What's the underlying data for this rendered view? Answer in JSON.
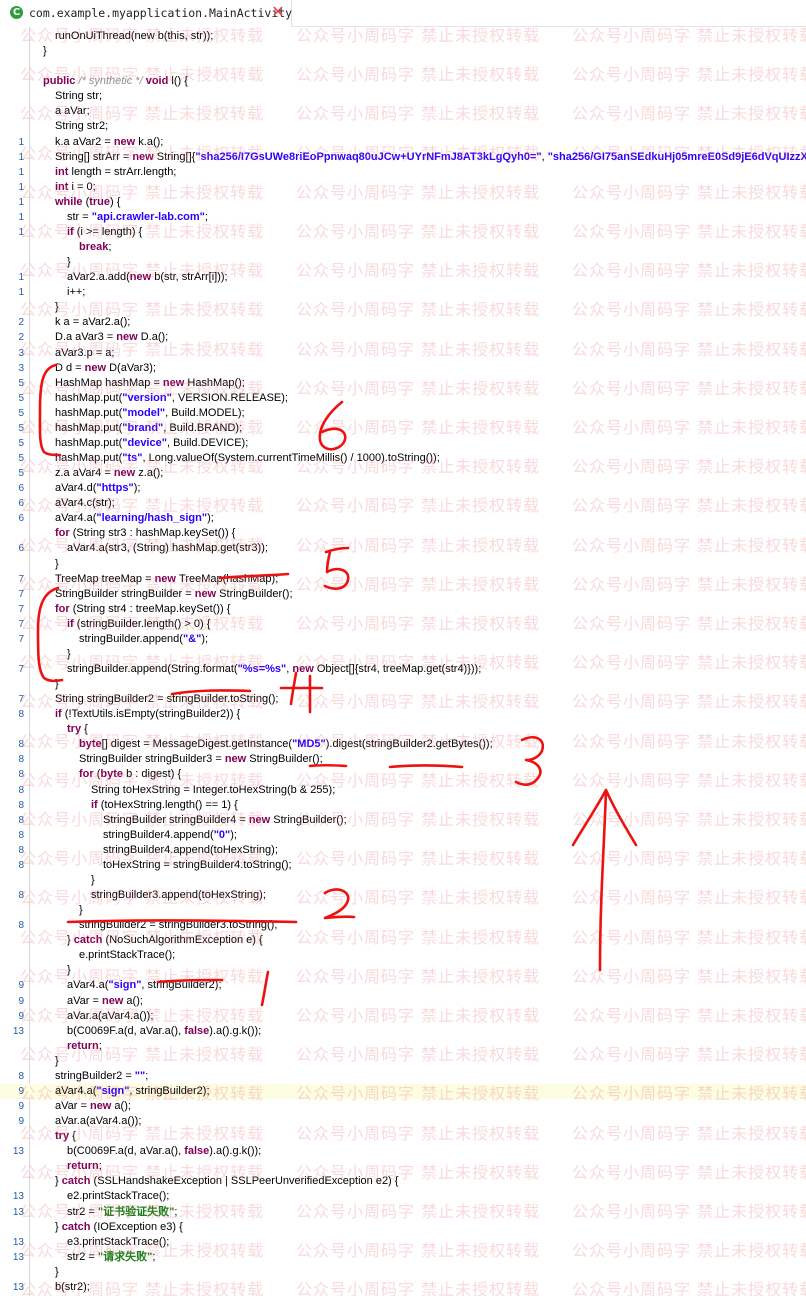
{
  "tab": {
    "title": "com.example.myapplication.MainActivity",
    "icon": "java-class-icon",
    "close_icon": "close-icon"
  },
  "watermark": "公众号小周码字 禁止未授权转载",
  "annotations": {
    "color": "#ee1111",
    "labels": [
      "6",
      "5",
      "4",
      "3",
      "2",
      "1"
    ]
  },
  "lines": [
    {
      "n": "",
      "indent": 2,
      "tokens": [
        [
          "",
          "runOnUiThread(new b(this, str));"
        ]
      ]
    },
    {
      "n": "",
      "indent": 1,
      "tokens": [
        [
          "",
          "}"
        ]
      ]
    },
    {
      "n": "",
      "indent": 0,
      "tokens": [
        [
          "",
          ""
        ]
      ]
    },
    {
      "n": "",
      "indent": 1,
      "tokens": [
        [
          "kw",
          "public "
        ],
        [
          "cm",
          "/* synthetic */ "
        ],
        [
          "kw",
          "void "
        ],
        [
          "",
          "l() {"
        ]
      ]
    },
    {
      "n": "",
      "indent": 2,
      "tokens": [
        [
          "",
          "String str;"
        ]
      ]
    },
    {
      "n": "",
      "indent": 2,
      "tokens": [
        [
          "",
          "a aVar;"
        ]
      ]
    },
    {
      "n": "",
      "indent": 2,
      "tokens": [
        [
          "",
          "String str2;"
        ]
      ]
    },
    {
      "n": "1",
      "indent": 2,
      "tokens": [
        [
          "",
          "k.a aVar2 = "
        ],
        [
          "kw",
          "new "
        ],
        [
          "",
          "k.a();"
        ]
      ]
    },
    {
      "n": "1",
      "indent": 2,
      "tokens": [
        [
          "",
          "String[] strArr = "
        ],
        [
          "kw",
          "new "
        ],
        [
          "",
          "String[]{"
        ],
        [
          "str",
          "\"sha256/I7GsUWe8riEoPpnwaq80uJCw+UYrNFmJ8AT3kLgQyh0=\""
        ],
        [
          "",
          ", "
        ],
        [
          "str",
          "\"sha256/GI75anSEdkuHj05mreE0Sd9jE6dVqUIzzXRHHlZBVbI=\""
        ]
      ]
    },
    {
      "n": "1",
      "indent": 2,
      "tokens": [
        [
          "kw",
          "int "
        ],
        [
          "",
          "length = strArr.length;"
        ]
      ]
    },
    {
      "n": "1",
      "indent": 2,
      "tokens": [
        [
          "kw",
          "int "
        ],
        [
          "",
          "i = 0;"
        ]
      ]
    },
    {
      "n": "1",
      "indent": 2,
      "tokens": [
        [
          "kw",
          "while "
        ],
        [
          "",
          "("
        ],
        [
          "kw",
          "true"
        ],
        [
          "",
          ") {"
        ]
      ]
    },
    {
      "n": "1",
      "indent": 3,
      "tokens": [
        [
          "",
          "str = "
        ],
        [
          "str",
          "\"api.crawler-lab.com\""
        ],
        [
          "",
          ";"
        ]
      ]
    },
    {
      "n": "1",
      "indent": 3,
      "tokens": [
        [
          "kw",
          "if "
        ],
        [
          "",
          "(i >= length) {"
        ]
      ]
    },
    {
      "n": "",
      "indent": 4,
      "tokens": [
        [
          "kw",
          "break"
        ],
        [
          "",
          ";"
        ]
      ]
    },
    {
      "n": "",
      "indent": 3,
      "tokens": [
        [
          "",
          "}"
        ]
      ]
    },
    {
      "n": "1",
      "indent": 3,
      "tokens": [
        [
          "",
          "aVar2.a.add("
        ],
        [
          "kw",
          "new "
        ],
        [
          "",
          "b(str, strArr[i]));"
        ]
      ]
    },
    {
      "n": "1",
      "indent": 3,
      "tokens": [
        [
          "",
          "i++;"
        ]
      ]
    },
    {
      "n": "",
      "indent": 2,
      "tokens": [
        [
          "",
          "}"
        ]
      ]
    },
    {
      "n": "2",
      "indent": 2,
      "tokens": [
        [
          "",
          "k a = aVar2.a();"
        ]
      ]
    },
    {
      "n": "2",
      "indent": 2,
      "tokens": [
        [
          "",
          "D.a aVar3 = "
        ],
        [
          "kw",
          "new "
        ],
        [
          "",
          "D.a();"
        ]
      ]
    },
    {
      "n": "3",
      "indent": 2,
      "tokens": [
        [
          "",
          "aVar3.p = a;"
        ]
      ]
    },
    {
      "n": "3",
      "indent": 2,
      "tokens": [
        [
          "",
          "D d = "
        ],
        [
          "kw",
          "new "
        ],
        [
          "",
          "D(aVar3);"
        ]
      ]
    },
    {
      "n": "5",
      "indent": 2,
      "tokens": [
        [
          "",
          "HashMap hashMap = "
        ],
        [
          "kw",
          "new "
        ],
        [
          "",
          "HashMap();"
        ]
      ]
    },
    {
      "n": "5",
      "indent": 2,
      "tokens": [
        [
          "",
          "hashMap.put("
        ],
        [
          "str",
          "\"version\""
        ],
        [
          "",
          ", VERSION.RELEASE);"
        ]
      ]
    },
    {
      "n": "5",
      "indent": 2,
      "tokens": [
        [
          "",
          "hashMap.put("
        ],
        [
          "str",
          "\"model\""
        ],
        [
          "",
          ", Build.MODEL);"
        ]
      ]
    },
    {
      "n": "5",
      "indent": 2,
      "tokens": [
        [
          "",
          "hashMap.put("
        ],
        [
          "str",
          "\"brand\""
        ],
        [
          "",
          ", Build.BRAND);"
        ]
      ]
    },
    {
      "n": "5",
      "indent": 2,
      "tokens": [
        [
          "",
          "hashMap.put("
        ],
        [
          "str",
          "\"device\""
        ],
        [
          "",
          ", Build.DEVICE);"
        ]
      ]
    },
    {
      "n": "5",
      "indent": 2,
      "tokens": [
        [
          "",
          "hashMap.put("
        ],
        [
          "str",
          "\"ts\""
        ],
        [
          "",
          ", Long.valueOf(System.currentTimeMillis() / 1000).toString());"
        ]
      ]
    },
    {
      "n": "5",
      "indent": 2,
      "tokens": [
        [
          "",
          "z.a aVar4 = "
        ],
        [
          "kw",
          "new "
        ],
        [
          "",
          "z.a();"
        ]
      ]
    },
    {
      "n": "6",
      "indent": 2,
      "tokens": [
        [
          "",
          "aVar4.d("
        ],
        [
          "str",
          "\"https\""
        ],
        [
          "",
          ");"
        ]
      ]
    },
    {
      "n": "6",
      "indent": 2,
      "tokens": [
        [
          "",
          "aVar4.c(str);"
        ]
      ]
    },
    {
      "n": "6",
      "indent": 2,
      "tokens": [
        [
          "",
          "aVar4.a("
        ],
        [
          "str",
          "\"learning/hash_sign\""
        ],
        [
          "",
          ");"
        ]
      ]
    },
    {
      "n": "",
      "indent": 2,
      "tokens": [
        [
          "kw",
          "for "
        ],
        [
          "",
          "(String str3 : hashMap.keySet()) {"
        ]
      ]
    },
    {
      "n": "6",
      "indent": 3,
      "tokens": [
        [
          "",
          "aVar4.a(str3, (String) hashMap.get(str3));"
        ]
      ]
    },
    {
      "n": "",
      "indent": 2,
      "tokens": [
        [
          "",
          "}"
        ]
      ]
    },
    {
      "n": "7",
      "indent": 2,
      "tokens": [
        [
          "",
          "TreeMap treeMap = "
        ],
        [
          "kw",
          "new "
        ],
        [
          "",
          "TreeMap(hashMap);"
        ]
      ]
    },
    {
      "n": "7",
      "indent": 2,
      "tokens": [
        [
          "",
          "StringBuilder stringBuilder = "
        ],
        [
          "kw",
          "new "
        ],
        [
          "",
          "StringBuilder();"
        ]
      ]
    },
    {
      "n": "7",
      "indent": 2,
      "tokens": [
        [
          "kw",
          "for "
        ],
        [
          "",
          "(String str4 : treeMap.keySet()) {"
        ]
      ]
    },
    {
      "n": "7",
      "indent": 3,
      "tokens": [
        [
          "kw",
          "if "
        ],
        [
          "",
          "(stringBuilder.length() > 0) {"
        ]
      ]
    },
    {
      "n": "7",
      "indent": 4,
      "tokens": [
        [
          "",
          "stringBuilder.append("
        ],
        [
          "str",
          "\"&\""
        ],
        [
          "",
          ");"
        ]
      ]
    },
    {
      "n": "",
      "indent": 3,
      "tokens": [
        [
          "",
          "}"
        ]
      ]
    },
    {
      "n": "7",
      "indent": 3,
      "tokens": [
        [
          "",
          "stringBuilder.append(String.format("
        ],
        [
          "str",
          "\"%s=%s\""
        ],
        [
          "",
          ", "
        ],
        [
          "kw",
          "new "
        ],
        [
          "",
          "Object[]{str4, treeMap.get(str4)}));"
        ]
      ]
    },
    {
      "n": "",
      "indent": 2,
      "tokens": [
        [
          "",
          "}"
        ]
      ]
    },
    {
      "n": "7",
      "indent": 2,
      "tokens": [
        [
          "",
          "String stringBuilder2 = stringBuilder.toString();"
        ]
      ]
    },
    {
      "n": "8",
      "indent": 2,
      "tokens": [
        [
          "kw",
          "if "
        ],
        [
          "",
          "(!TextUtils.isEmpty(stringBuilder2)) {"
        ]
      ]
    },
    {
      "n": "",
      "indent": 3,
      "tokens": [
        [
          "kw",
          "try "
        ],
        [
          "",
          "{"
        ]
      ]
    },
    {
      "n": "8",
      "indent": 4,
      "tokens": [
        [
          "kw",
          "byte"
        ],
        [
          "",
          "[] digest = MessageDigest.getInstance("
        ],
        [
          "str",
          "\"MD5\""
        ],
        [
          "",
          ").digest(stringBuilder2.getBytes());"
        ]
      ]
    },
    {
      "n": "8",
      "indent": 4,
      "tokens": [
        [
          "",
          "StringBuilder stringBuilder3 = "
        ],
        [
          "kw",
          "new "
        ],
        [
          "",
          "StringBuilder();"
        ]
      ]
    },
    {
      "n": "8",
      "indent": 4,
      "tokens": [
        [
          "kw",
          "for "
        ],
        [
          "",
          "("
        ],
        [
          "kw",
          "byte "
        ],
        [
          "",
          "b : digest) {"
        ]
      ]
    },
    {
      "n": "8",
      "indent": 5,
      "tokens": [
        [
          "",
          "String toHexString = Integer.toHexString(b & 255);"
        ]
      ]
    },
    {
      "n": "8",
      "indent": 5,
      "tokens": [
        [
          "kw",
          "if "
        ],
        [
          "",
          "(toHexString.length() == 1) {"
        ]
      ]
    },
    {
      "n": "8",
      "indent": 6,
      "tokens": [
        [
          "",
          "StringBuilder stringBuilder4 = "
        ],
        [
          "kw",
          "new "
        ],
        [
          "",
          "StringBuilder();"
        ]
      ]
    },
    {
      "n": "8",
      "indent": 6,
      "tokens": [
        [
          "",
          "stringBuilder4.append("
        ],
        [
          "str",
          "\"0\""
        ],
        [
          "",
          ");"
        ]
      ]
    },
    {
      "n": "8",
      "indent": 6,
      "tokens": [
        [
          "",
          "stringBuilder4.append(toHexString);"
        ]
      ]
    },
    {
      "n": "8",
      "indent": 6,
      "tokens": [
        [
          "",
          "toHexString = stringBuilder4.toString();"
        ]
      ]
    },
    {
      "n": "",
      "indent": 5,
      "tokens": [
        [
          "",
          "}"
        ]
      ]
    },
    {
      "n": "8",
      "indent": 5,
      "tokens": [
        [
          "",
          "stringBuilder3.append(toHexString);"
        ]
      ]
    },
    {
      "n": "",
      "indent": 4,
      "tokens": [
        [
          "",
          "}"
        ]
      ]
    },
    {
      "n": "8",
      "indent": 4,
      "tokens": [
        [
          "",
          "stringBuilder2 = stringBuilder3.toString();"
        ]
      ]
    },
    {
      "n": "",
      "indent": 3,
      "tokens": [
        [
          "",
          "} "
        ],
        [
          "kw",
          "catch "
        ],
        [
          "",
          "(NoSuchAlgorithmException e) {"
        ]
      ]
    },
    {
      "n": "",
      "indent": 4,
      "tokens": [
        [
          "",
          "e.printStackTrace();"
        ]
      ]
    },
    {
      "n": "",
      "indent": 3,
      "tokens": [
        [
          "",
          "}"
        ]
      ]
    },
    {
      "n": "9",
      "indent": 3,
      "tokens": [
        [
          "",
          "aVar4.a("
        ],
        [
          "str",
          "\"sign\""
        ],
        [
          "",
          ", stringBuilder2);"
        ]
      ]
    },
    {
      "n": "9",
      "indent": 3,
      "tokens": [
        [
          "",
          "aVar = "
        ],
        [
          "kw",
          "new "
        ],
        [
          "",
          "a();"
        ]
      ]
    },
    {
      "n": "9",
      "indent": 3,
      "tokens": [
        [
          "",
          "aVar.a(aVar4.a());"
        ]
      ]
    },
    {
      "n": "13",
      "indent": 3,
      "tokens": [
        [
          "",
          "b(C0069F.a(d, aVar.a(), "
        ],
        [
          "kw",
          "false"
        ],
        [
          "",
          ").a().g.k());"
        ]
      ]
    },
    {
      "n": "",
      "indent": 3,
      "tokens": [
        [
          "kw",
          "return"
        ],
        [
          "",
          ";"
        ]
      ]
    },
    {
      "n": "",
      "indent": 2,
      "tokens": [
        [
          "",
          "}"
        ]
      ]
    },
    {
      "n": "8",
      "indent": 2,
      "tokens": [
        [
          "",
          "stringBuilder2 = "
        ],
        [
          "str",
          "\"\""
        ],
        [
          "",
          ";"
        ]
      ]
    },
    {
      "n": "9",
      "indent": 2,
      "hl": true,
      "tokens": [
        [
          "",
          "aVar4.a("
        ],
        [
          "str",
          "\"sign\""
        ],
        [
          "",
          ", stringBuilder2);"
        ]
      ]
    },
    {
      "n": "9",
      "indent": 2,
      "tokens": [
        [
          "",
          "aVar = "
        ],
        [
          "kw",
          "new "
        ],
        [
          "",
          "a();"
        ]
      ]
    },
    {
      "n": "9",
      "indent": 2,
      "tokens": [
        [
          "",
          "aVar.a(aVar4.a());"
        ]
      ]
    },
    {
      "n": "",
      "indent": 2,
      "tokens": [
        [
          "kw",
          "try "
        ],
        [
          "",
          "{"
        ]
      ]
    },
    {
      "n": "13",
      "indent": 3,
      "tokens": [
        [
          "",
          "b(C0069F.a(d, aVar.a(), "
        ],
        [
          "kw",
          "false"
        ],
        [
          "",
          ").a().g.k());"
        ]
      ]
    },
    {
      "n": "",
      "indent": 3,
      "tokens": [
        [
          "kw",
          "return"
        ],
        [
          "",
          ";"
        ]
      ]
    },
    {
      "n": "",
      "indent": 2,
      "tokens": [
        [
          "",
          "} "
        ],
        [
          "kw",
          "catch "
        ],
        [
          "",
          "(SSLHandshakeException | SSLPeerUnverifiedException e2) {"
        ]
      ]
    },
    {
      "n": "13",
      "indent": 3,
      "tokens": [
        [
          "",
          "e2.printStackTrace();"
        ]
      ]
    },
    {
      "n": "13",
      "indent": 3,
      "tokens": [
        [
          "",
          "str2 = "
        ],
        [
          "str g",
          "\"证书验证失败\""
        ],
        [
          "",
          ";"
        ]
      ]
    },
    {
      "n": "",
      "indent": 2,
      "tokens": [
        [
          "",
          "} "
        ],
        [
          "kw",
          "catch "
        ],
        [
          "",
          "(IOException e3) {"
        ]
      ]
    },
    {
      "n": "13",
      "indent": 3,
      "tokens": [
        [
          "",
          "e3.printStackTrace();"
        ]
      ]
    },
    {
      "n": "13",
      "indent": 3,
      "tokens": [
        [
          "",
          "str2 = "
        ],
        [
          "str g",
          "\"请求失败\""
        ],
        [
          "",
          ";"
        ]
      ]
    },
    {
      "n": "",
      "indent": 2,
      "tokens": [
        [
          "",
          "}"
        ]
      ]
    },
    {
      "n": "13",
      "indent": 2,
      "tokens": [
        [
          "",
          "b(str2);"
        ]
      ]
    },
    {
      "n": "",
      "indent": 1,
      "tokens": [
        [
          "",
          "}"
        ]
      ]
    }
  ]
}
